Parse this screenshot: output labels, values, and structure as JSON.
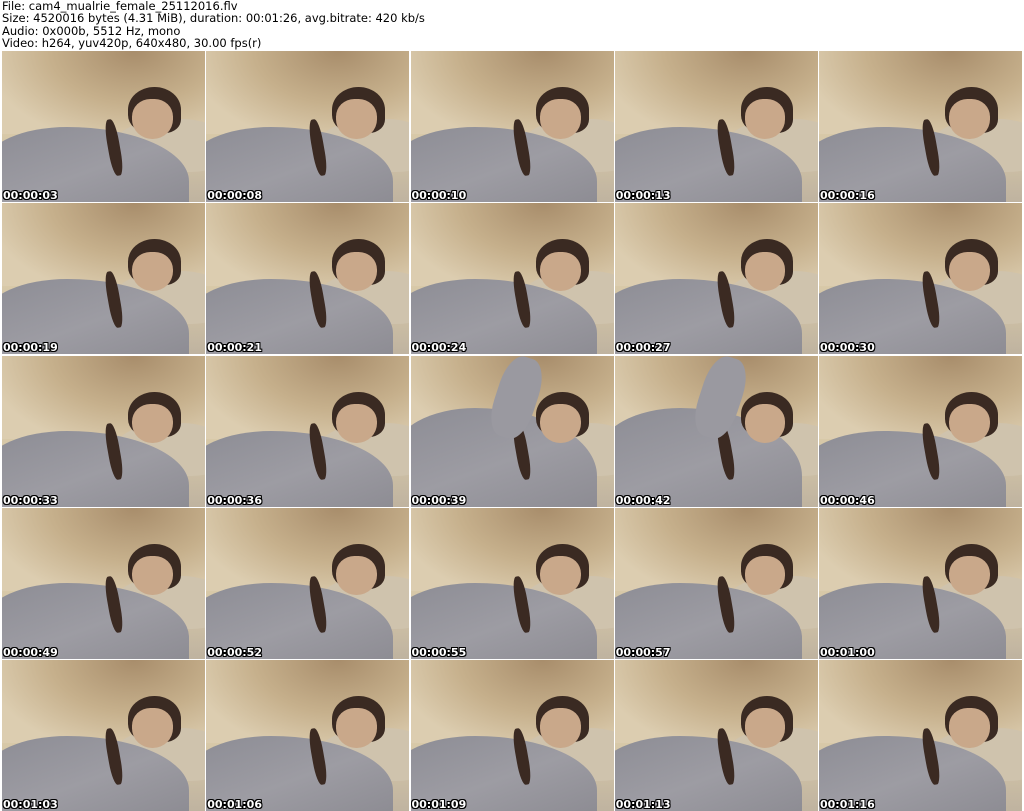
{
  "header": {
    "file_line": "File: cam4_mualrie_female_25112016.flv",
    "size_line": "Size: 4520016 bytes (4.31 MiB), duration: 00:01:26, avg.bitrate: 420 kb/s",
    "audio_line": "Audio: 0x000b, 5512 Hz, mono",
    "video_line": "Video: h264, yuv420p, 640x480, 30.00 fps(r)"
  },
  "thumbnails": [
    {
      "timestamp": "00:00:03",
      "pose": "lying"
    },
    {
      "timestamp": "00:00:08",
      "pose": "lying"
    },
    {
      "timestamp": "00:00:10",
      "pose": "lying"
    },
    {
      "timestamp": "00:00:13",
      "pose": "lying"
    },
    {
      "timestamp": "00:00:16",
      "pose": "lying"
    },
    {
      "timestamp": "00:00:19",
      "pose": "lying"
    },
    {
      "timestamp": "00:00:21",
      "pose": "lying"
    },
    {
      "timestamp": "00:00:24",
      "pose": "lying"
    },
    {
      "timestamp": "00:00:27",
      "pose": "lying"
    },
    {
      "timestamp": "00:00:30",
      "pose": "lying"
    },
    {
      "timestamp": "00:00:33",
      "pose": "lying"
    },
    {
      "timestamp": "00:00:36",
      "pose": "lying"
    },
    {
      "timestamp": "00:00:39",
      "pose": "raised-arm"
    },
    {
      "timestamp": "00:00:42",
      "pose": "raised-arm"
    },
    {
      "timestamp": "00:00:46",
      "pose": "lying"
    },
    {
      "timestamp": "00:00:49",
      "pose": "lying"
    },
    {
      "timestamp": "00:00:52",
      "pose": "lying"
    },
    {
      "timestamp": "00:00:55",
      "pose": "lying"
    },
    {
      "timestamp": "00:00:57",
      "pose": "lying"
    },
    {
      "timestamp": "00:01:00",
      "pose": "lying"
    },
    {
      "timestamp": "00:01:03",
      "pose": "lying"
    },
    {
      "timestamp": "00:01:06",
      "pose": "lying"
    },
    {
      "timestamp": "00:01:09",
      "pose": "lying"
    },
    {
      "timestamp": "00:01:13",
      "pose": "lying"
    },
    {
      "timestamp": "00:01:16",
      "pose": "lying"
    }
  ],
  "colors": {
    "background": "#ffffff",
    "timestamp_text": "#ffffff",
    "timestamp_outline": "#000000"
  }
}
